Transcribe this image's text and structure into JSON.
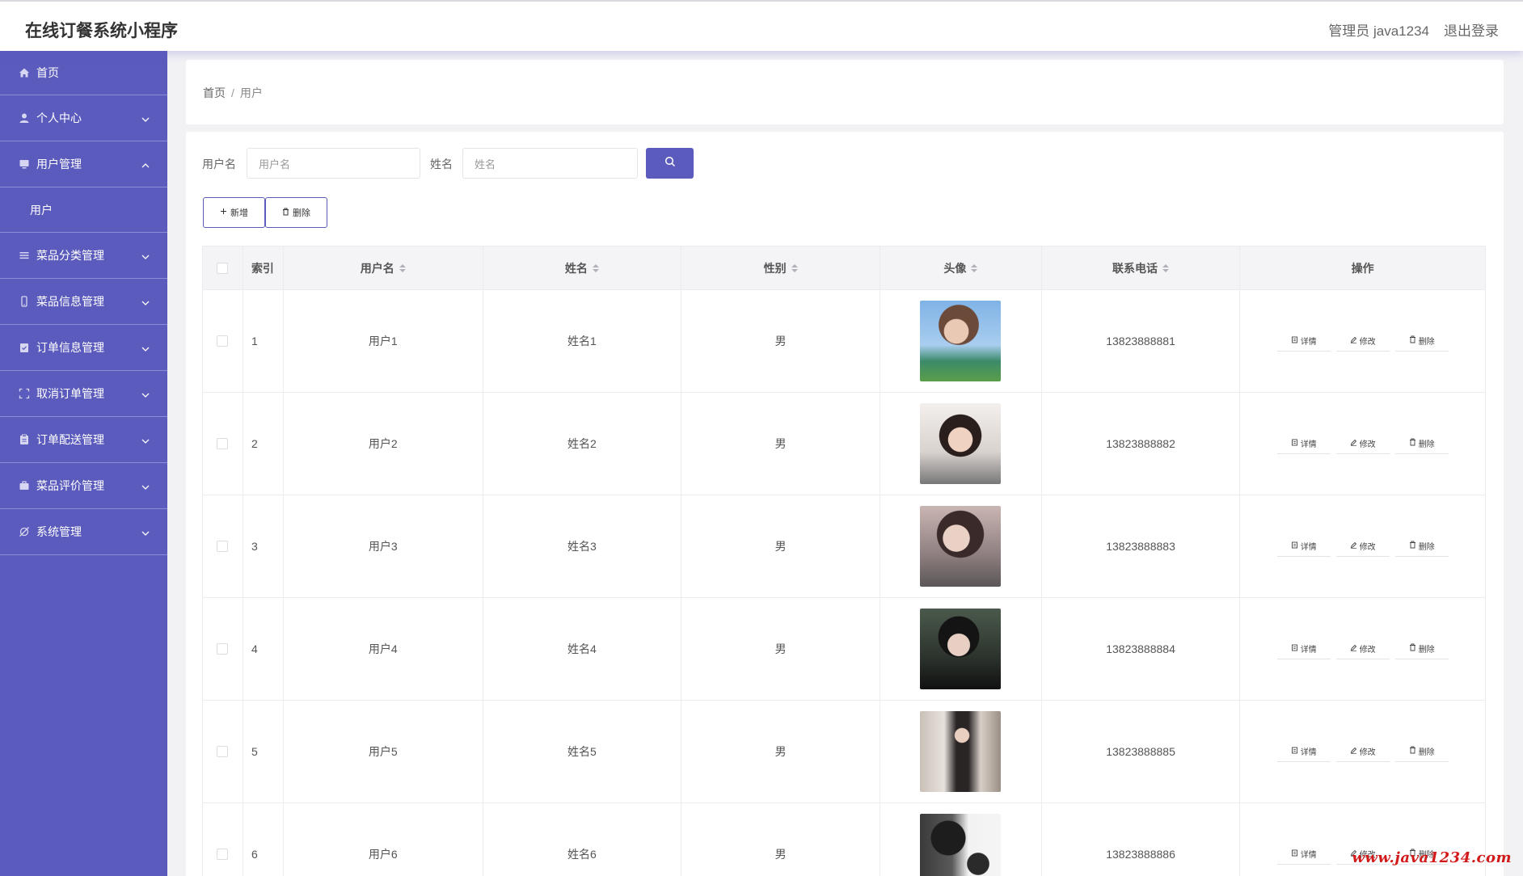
{
  "header": {
    "title": "在线订餐系统小程序",
    "admin": "管理员 java1234",
    "logout": "退出登录"
  },
  "sidebar": {
    "items": [
      {
        "label": "首页",
        "icon": "home-icon",
        "expandable": false
      },
      {
        "label": "个人中心",
        "icon": "user-icon",
        "expandable": true
      },
      {
        "label": "用户管理",
        "icon": "monitor-icon",
        "expandable": true,
        "expanded": true,
        "children": [
          "用户"
        ]
      },
      {
        "label": "菜品分类管理",
        "icon": "list-icon",
        "expandable": true
      },
      {
        "label": "菜品信息管理",
        "icon": "phone-icon",
        "expandable": true
      },
      {
        "label": "订单信息管理",
        "icon": "clipboard-check-icon",
        "expandable": true
      },
      {
        "label": "取消订单管理",
        "icon": "fullscreen-icon",
        "expandable": true
      },
      {
        "label": "订单配送管理",
        "icon": "clipboard-icon",
        "expandable": true
      },
      {
        "label": "菜品评价管理",
        "icon": "briefcase-icon",
        "expandable": true
      },
      {
        "label": "系统管理",
        "icon": "settings-off-icon",
        "expandable": true
      }
    ]
  },
  "breadcrumb": {
    "home": "首页",
    "sep": "/",
    "current": "用户"
  },
  "search": {
    "username_label": "用户名",
    "username_placeholder": "用户名",
    "name_label": "姓名",
    "name_placeholder": "姓名"
  },
  "toolbar": {
    "add": "新增",
    "delete": "删除"
  },
  "table": {
    "headers": {
      "index": "索引",
      "username": "用户名",
      "name": "姓名",
      "gender": "性别",
      "avatar": "头像",
      "phone": "联系电话",
      "actions": "操作"
    },
    "action_labels": {
      "detail": "详情",
      "edit": "修改",
      "delete": "删除"
    },
    "rows": [
      {
        "index": "1",
        "username": "用户1",
        "name": "姓名1",
        "gender": "男",
        "phone": "13823888881"
      },
      {
        "index": "2",
        "username": "用户2",
        "name": "姓名2",
        "gender": "男",
        "phone": "13823888882"
      },
      {
        "index": "3",
        "username": "用户3",
        "name": "姓名3",
        "gender": "男",
        "phone": "13823888883"
      },
      {
        "index": "4",
        "username": "用户4",
        "name": "姓名4",
        "gender": "男",
        "phone": "13823888884"
      },
      {
        "index": "5",
        "username": "用户5",
        "name": "姓名5",
        "gender": "男",
        "phone": "13823888885"
      },
      {
        "index": "6",
        "username": "用户6",
        "name": "姓名6",
        "gender": "男",
        "phone": "13823888886"
      }
    ]
  },
  "watermark": "www.java1234.com",
  "colors": {
    "accent": "#5b5bbd",
    "sidebar_divider": "#8b8bd6",
    "watermark": "#d21a1a"
  }
}
